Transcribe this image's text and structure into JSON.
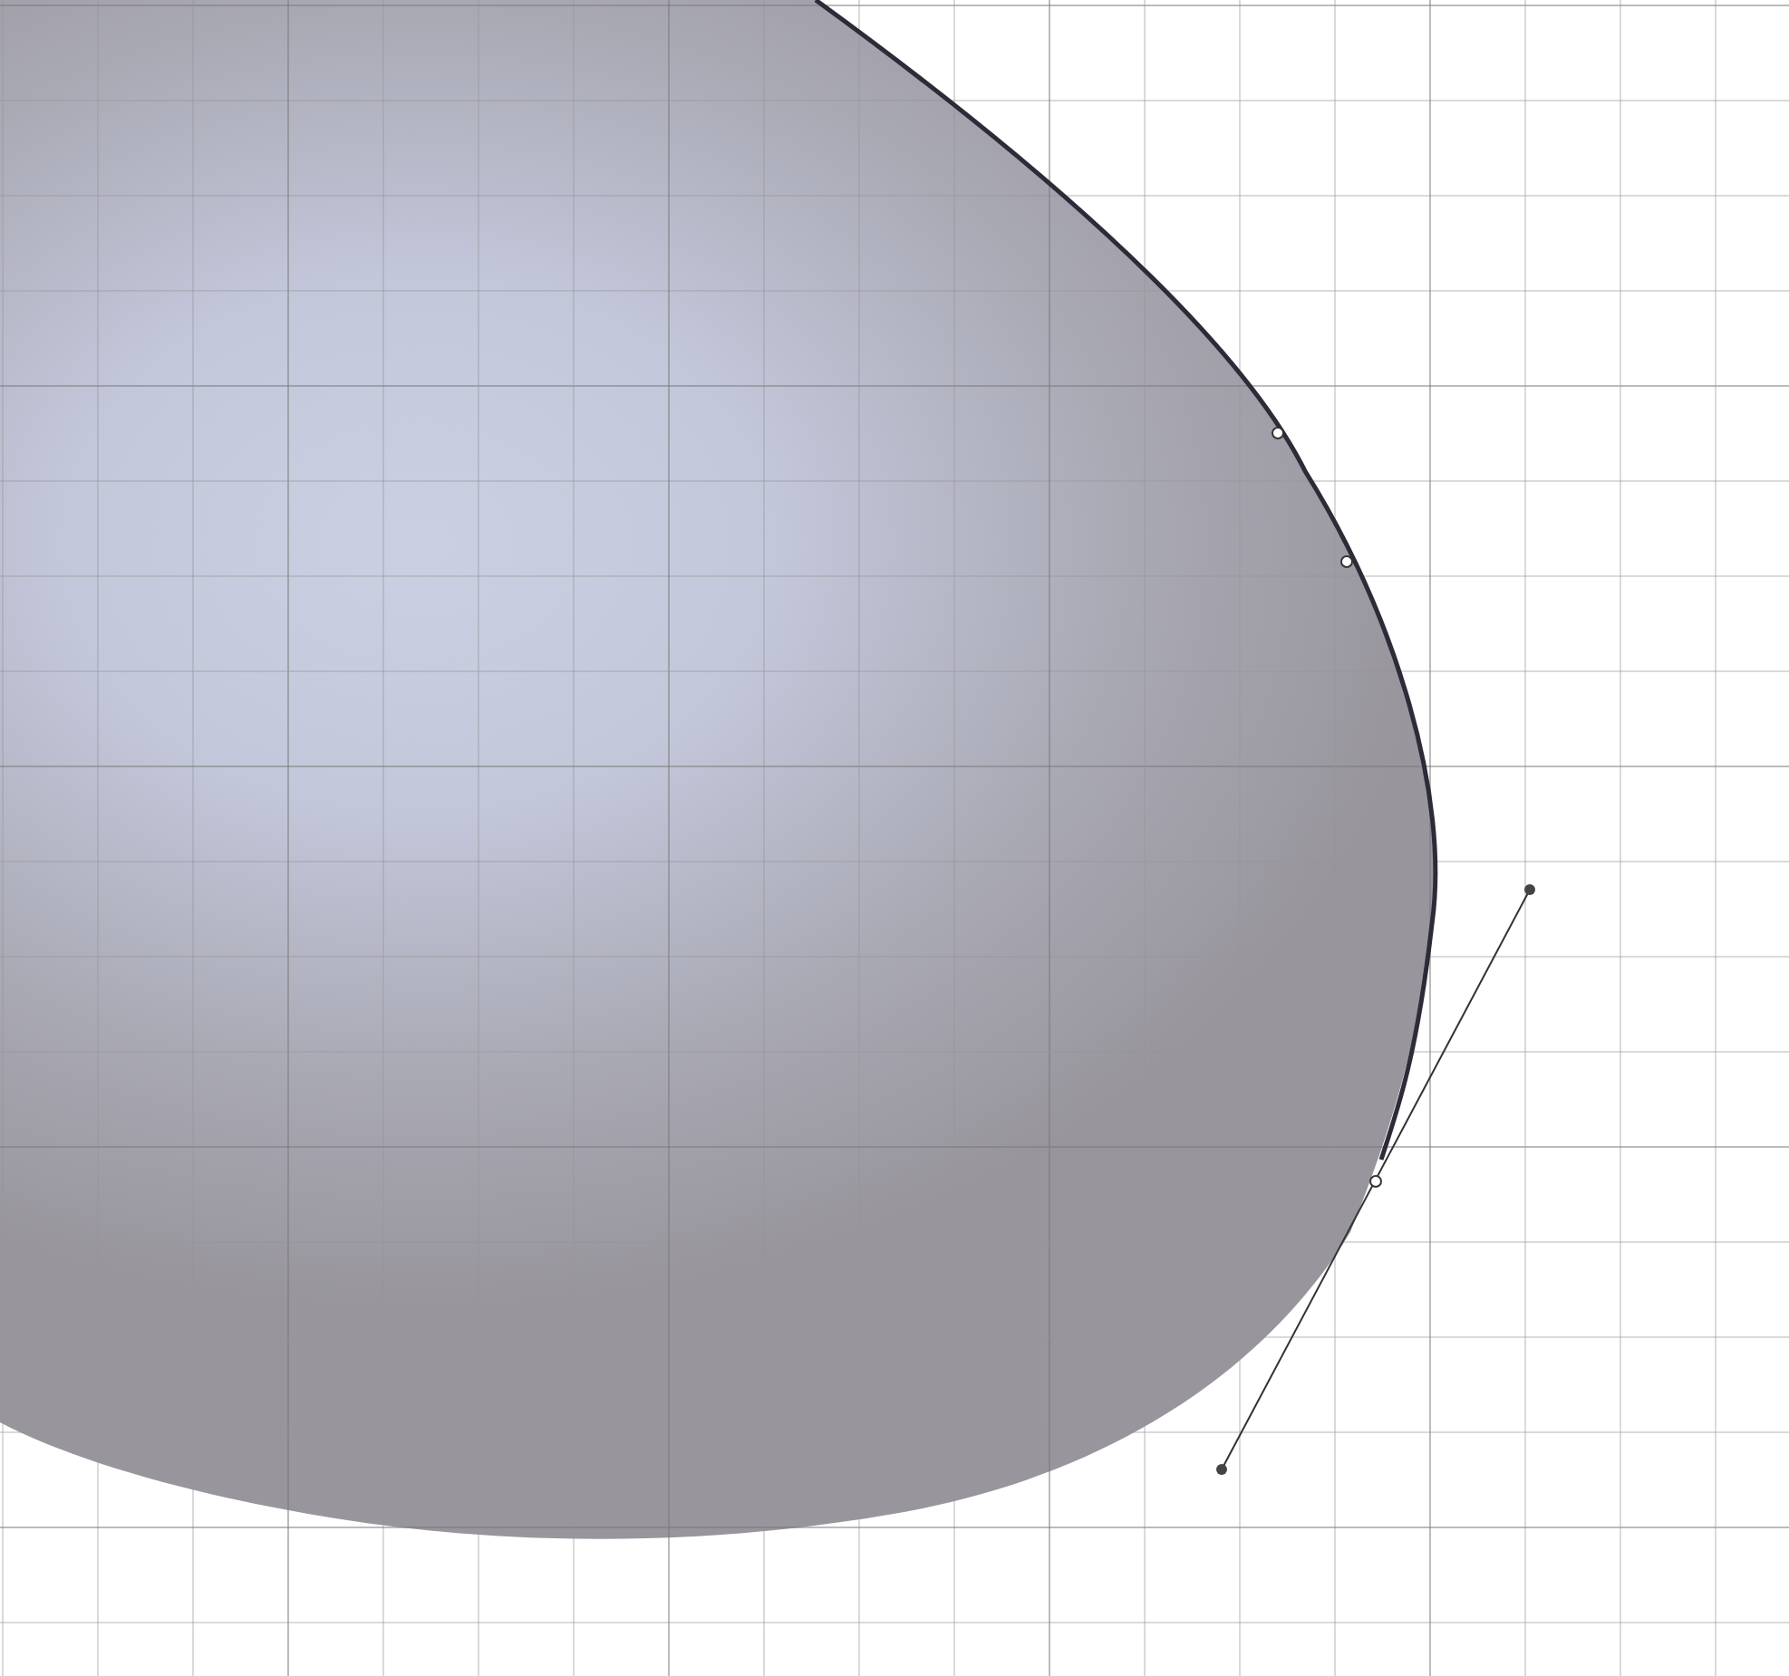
{
  "canvas": {
    "grid": true,
    "handles": true
  }
}
